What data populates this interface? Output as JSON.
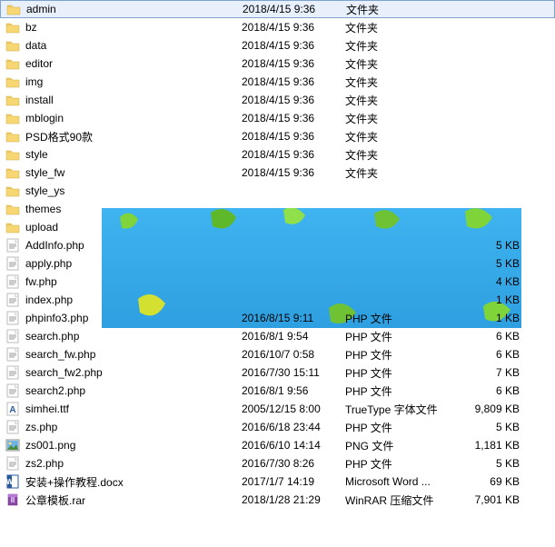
{
  "icons": {
    "folder": "folder",
    "php": "php",
    "font": "font",
    "png": "png",
    "docx": "docx",
    "rar": "rar"
  },
  "rows": [
    {
      "icon": "folder",
      "name": "admin",
      "date": "2018/4/15 9:36",
      "type": "文件夹",
      "size": "",
      "selected": true
    },
    {
      "icon": "folder",
      "name": "bz",
      "date": "2018/4/15 9:36",
      "type": "文件夹",
      "size": ""
    },
    {
      "icon": "folder",
      "name": "data",
      "date": "2018/4/15 9:36",
      "type": "文件夹",
      "size": ""
    },
    {
      "icon": "folder",
      "name": "editor",
      "date": "2018/4/15 9:36",
      "type": "文件夹",
      "size": ""
    },
    {
      "icon": "folder",
      "name": "img",
      "date": "2018/4/15 9:36",
      "type": "文件夹",
      "size": ""
    },
    {
      "icon": "folder",
      "name": "install",
      "date": "2018/4/15 9:36",
      "type": "文件夹",
      "size": ""
    },
    {
      "icon": "folder",
      "name": "mblogin",
      "date": "2018/4/15 9:36",
      "type": "文件夹",
      "size": ""
    },
    {
      "icon": "folder",
      "name": "PSD格式90款",
      "date": "2018/4/15 9:36",
      "type": "文件夹",
      "size": ""
    },
    {
      "icon": "folder",
      "name": "style",
      "date": "2018/4/15 9:36",
      "type": "文件夹",
      "size": ""
    },
    {
      "icon": "folder",
      "name": "style_fw",
      "date": "2018/4/15 9:36",
      "type": "文件夹",
      "size": ""
    },
    {
      "icon": "folder",
      "name": "style_ys",
      "date": "",
      "type": "",
      "size": ""
    },
    {
      "icon": "folder",
      "name": "themes",
      "date": "",
      "type": "",
      "size": ""
    },
    {
      "icon": "folder",
      "name": "upload",
      "date": "",
      "type": "",
      "size": ""
    },
    {
      "icon": "php",
      "name": "AddInfo.php",
      "date": "",
      "type": "",
      "size": "5 KB"
    },
    {
      "icon": "php",
      "name": "apply.php",
      "date": "",
      "type": "",
      "size": "5 KB"
    },
    {
      "icon": "php",
      "name": "fw.php",
      "date": "",
      "type": "",
      "size": "4 KB"
    },
    {
      "icon": "php",
      "name": "index.php",
      "date": "",
      "type": "",
      "size": "1 KB"
    },
    {
      "icon": "php",
      "name": "phpinfo3.php",
      "date": "2016/8/15 9:11",
      "type": "PHP 文件",
      "size": "1 KB"
    },
    {
      "icon": "php",
      "name": "search.php",
      "date": "2016/8/1 9:54",
      "type": "PHP 文件",
      "size": "6 KB"
    },
    {
      "icon": "php",
      "name": "search_fw.php",
      "date": "2016/10/7 0:58",
      "type": "PHP 文件",
      "size": "6 KB"
    },
    {
      "icon": "php",
      "name": "search_fw2.php",
      "date": "2016/7/30 15:11",
      "type": "PHP 文件",
      "size": "7 KB"
    },
    {
      "icon": "php",
      "name": "search2.php",
      "date": "2016/8/1 9:56",
      "type": "PHP 文件",
      "size": "6 KB"
    },
    {
      "icon": "font",
      "name": "simhei.ttf",
      "date": "2005/12/15 8:00",
      "type": "TrueType 字体文件",
      "size": "9,809 KB"
    },
    {
      "icon": "php",
      "name": "zs.php",
      "date": "2016/6/18 23:44",
      "type": "PHP 文件",
      "size": "5 KB"
    },
    {
      "icon": "png",
      "name": "zs001.png",
      "date": "2016/6/10 14:14",
      "type": "PNG 文件",
      "size": "1,181 KB"
    },
    {
      "icon": "php",
      "name": "zs2.php",
      "date": "2016/7/30 8:26",
      "type": "PHP 文件",
      "size": "5 KB"
    },
    {
      "icon": "docx",
      "name": "安装+操作教程.docx",
      "date": "2017/1/7 14:19",
      "type": "Microsoft Word ...",
      "size": "69 KB"
    },
    {
      "icon": "rar",
      "name": "公章模板.rar",
      "date": "2018/1/28 21:29",
      "type": "WinRAR 压缩文件",
      "size": "7,901 KB"
    }
  ]
}
